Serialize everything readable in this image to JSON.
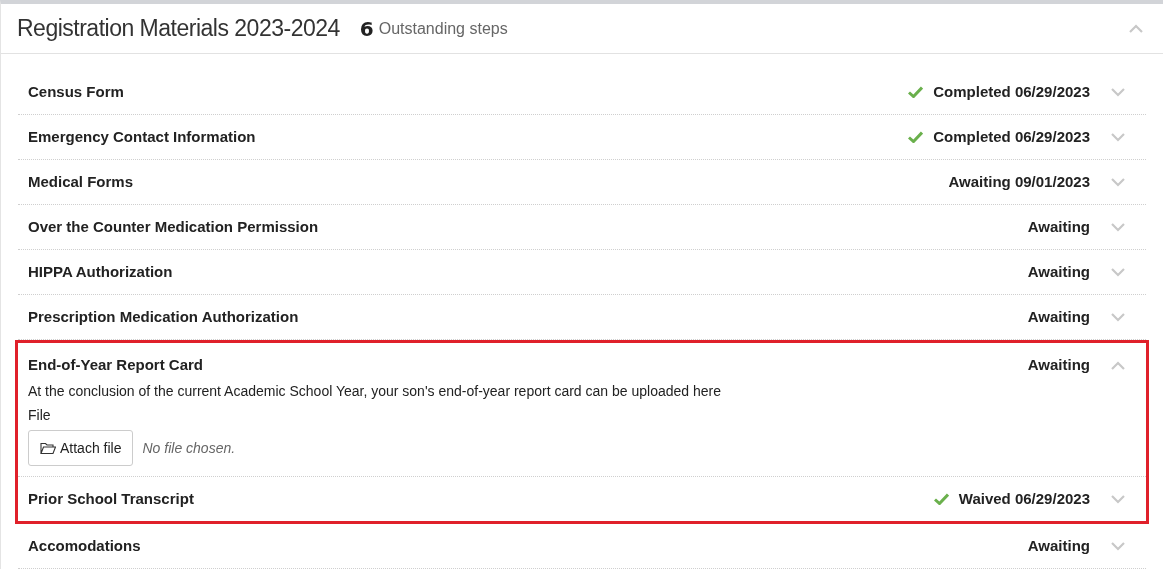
{
  "panel": {
    "title": "Registration Materials 2023-2024",
    "outstanding_count": "6",
    "outstanding_label": "Outstanding steps",
    "expanded": true
  },
  "steps": [
    {
      "title": "Census Form",
      "status": "Completed 06/29/2023",
      "checked": true,
      "expanded": false,
      "highlighted": false
    },
    {
      "title": "Emergency Contact Information",
      "status": "Completed 06/29/2023",
      "checked": true,
      "expanded": false,
      "highlighted": false
    },
    {
      "title": "Medical Forms",
      "status": "Awaiting 09/01/2023",
      "checked": false,
      "expanded": false,
      "highlighted": false
    },
    {
      "title": "Over the Counter Medication Permission",
      "status": "Awaiting",
      "checked": false,
      "expanded": false,
      "highlighted": false
    },
    {
      "title": "HIPPA Authorization",
      "status": "Awaiting",
      "checked": false,
      "expanded": false,
      "highlighted": false
    },
    {
      "title": "Prescription Medication Authorization",
      "status": "Awaiting",
      "checked": false,
      "expanded": false,
      "highlighted": false
    },
    {
      "title": "End-of-Year Report Card",
      "status": "Awaiting",
      "checked": false,
      "expanded": true,
      "highlighted": true,
      "description": "At the conclusion of the current Academic School Year, your son's end-of-year report card can be uploaded here",
      "file_label": "File",
      "attach_button": "Attach file",
      "file_status": "No file chosen."
    },
    {
      "title": "Prior School Transcript",
      "status": "Waived 06/29/2023",
      "checked": true,
      "expanded": false,
      "highlighted": true
    },
    {
      "title": "Accomodations",
      "status": "Awaiting",
      "checked": false,
      "expanded": false,
      "highlighted": false
    }
  ]
}
